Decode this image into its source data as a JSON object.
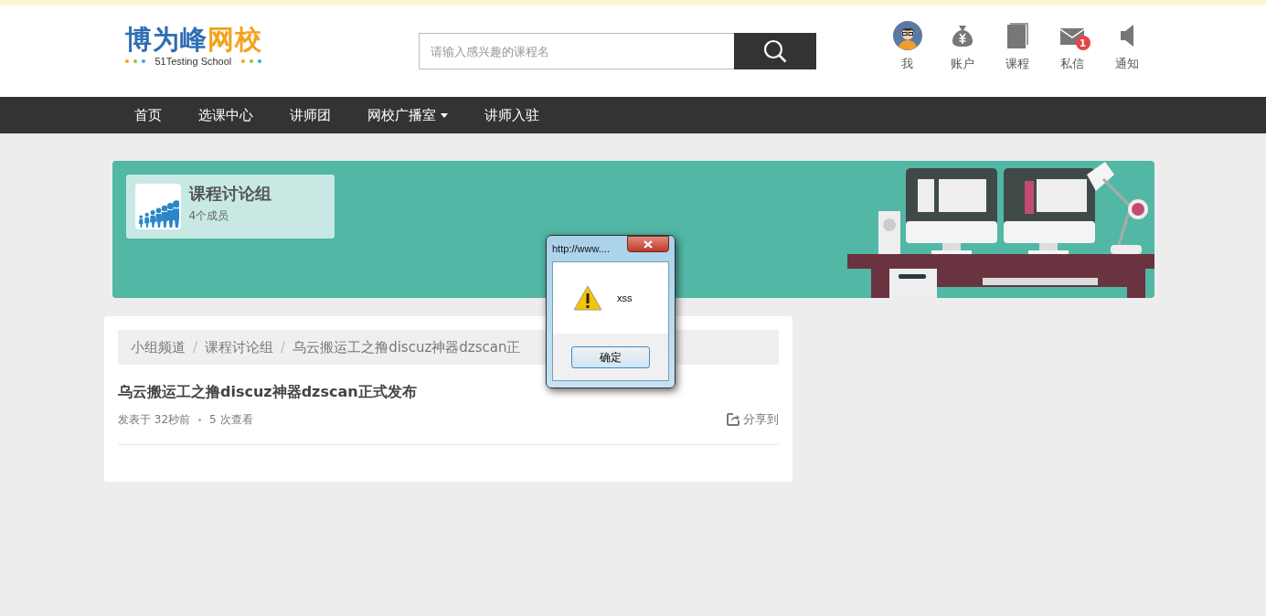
{
  "header": {
    "logo": {
      "name_primary": "博为峰",
      "name_accent": "网校",
      "tagline": "51Testing School"
    },
    "search": {
      "placeholder": "请输入感兴趣的课程名"
    },
    "user_menu": [
      {
        "kind": "avatar",
        "label": "我"
      },
      {
        "kind": "wallet",
        "label": "账户"
      },
      {
        "kind": "book",
        "label": "课程"
      },
      {
        "kind": "mail",
        "label": "私信",
        "badge": "1"
      },
      {
        "kind": "speaker",
        "label": "通知"
      }
    ]
  },
  "nav": [
    {
      "label": "首页",
      "dropdown": false
    },
    {
      "label": "选课中心",
      "dropdown": false
    },
    {
      "label": "讲师团",
      "dropdown": false
    },
    {
      "label": "网校广播室",
      "dropdown": true
    },
    {
      "label": "讲师入驻",
      "dropdown": false
    }
  ],
  "group": {
    "name": "课程讨论组",
    "members": "4个成员"
  },
  "breadcrumb": {
    "separator": "/",
    "items": [
      "小组频道",
      "课程讨论组",
      "乌云搬运工之撸discuz神器dzscan正"
    ]
  },
  "post": {
    "title": "乌云搬运工之撸discuz神器dzscan正式发布",
    "posted": "发表于 32秒前",
    "views": "5 次查看",
    "share": "分享到"
  },
  "dialog": {
    "title": "http://www....",
    "message": "xss",
    "button": "确定"
  }
}
